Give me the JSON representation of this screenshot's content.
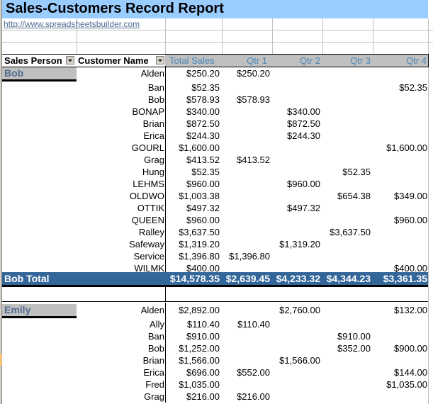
{
  "report": {
    "title": "Sales-Customers Record Report",
    "link": "http://www.spreadsheetsbuilder.com"
  },
  "table": {
    "headers": {
      "sales_person": "Sales Person",
      "customer_name": "Customer Name",
      "total_sales": "Total Sales",
      "qtr1": "Qtr 1",
      "qtr2": "Qtr 2",
      "qtr3": "Qtr 3",
      "qtr4": "Qtr 4"
    },
    "groups": [
      {
        "person": "Bob",
        "rows": [
          {
            "customer": "Alden",
            "total": "$250.20",
            "q1": "$250.20",
            "q2": "",
            "q3": "",
            "q4": ""
          },
          {
            "customer": "Ban",
            "total": "$52.35",
            "q1": "",
            "q2": "",
            "q3": "",
            "q4": "$52.35"
          },
          {
            "customer": "Bob",
            "total": "$578.93",
            "q1": "$578.93",
            "q2": "",
            "q3": "",
            "q4": ""
          },
          {
            "customer": "BONAP",
            "total": "$340.00",
            "q1": "",
            "q2": "$340.00",
            "q3": "",
            "q4": ""
          },
          {
            "customer": "Brian",
            "total": "$872.50",
            "q1": "",
            "q2": "$872.50",
            "q3": "",
            "q4": ""
          },
          {
            "customer": "Erica",
            "total": "$244.30",
            "q1": "",
            "q2": "$244.30",
            "q3": "",
            "q4": ""
          },
          {
            "customer": "GOURL",
            "total": "$1,600.00",
            "q1": "",
            "q2": "",
            "q3": "",
            "q4": "$1,600.00"
          },
          {
            "customer": "Grag",
            "total": "$413.52",
            "q1": "$413.52",
            "q2": "",
            "q3": "",
            "q4": ""
          },
          {
            "customer": "Hung",
            "total": "$52.35",
            "q1": "",
            "q2": "",
            "q3": "$52.35",
            "q4": ""
          },
          {
            "customer": "LEHMS",
            "total": "$960.00",
            "q1": "",
            "q2": "$960.00",
            "q3": "",
            "q4": ""
          },
          {
            "customer": "OLDWO",
            "total": "$1,003.38",
            "q1": "",
            "q2": "",
            "q3": "$654.38",
            "q4": "$349.00"
          },
          {
            "customer": "OTTIK",
            "total": "$497.32",
            "q1": "",
            "q2": "$497.32",
            "q3": "",
            "q4": ""
          },
          {
            "customer": "QUEEN",
            "total": "$960.00",
            "q1": "",
            "q2": "",
            "q3": "",
            "q4": "$960.00"
          },
          {
            "customer": "Ralley",
            "total": "$3,637.50",
            "q1": "",
            "q2": "",
            "q3": "$3,637.50",
            "q4": ""
          },
          {
            "customer": "Safeway",
            "total": "$1,319.20",
            "q1": "",
            "q2": "$1,319.20",
            "q3": "",
            "q4": ""
          },
          {
            "customer": "Service",
            "total": "$1,396.80",
            "q1": "$1,396.80",
            "q2": "",
            "q3": "",
            "q4": ""
          },
          {
            "customer": "WILMK",
            "total": "$400.00",
            "q1": "",
            "q2": "",
            "q3": "",
            "q4": "$400.00"
          }
        ],
        "total_label": "Bob Total",
        "totals": {
          "total": "$14,578.35",
          "q1": "$2,639.45",
          "q2": "$4,233.32",
          "q3": "$4,344.23",
          "q4": "$3,361.35"
        }
      },
      {
        "person": "Emily",
        "rows": [
          {
            "customer": "Alden",
            "total": "$2,892.00",
            "q1": "",
            "q2": "$2,760.00",
            "q3": "",
            "q4": "$132.00"
          },
          {
            "customer": "Ally",
            "total": "$110.40",
            "q1": "$110.40",
            "q2": "",
            "q3": "",
            "q4": ""
          },
          {
            "customer": "Ban",
            "total": "$910.00",
            "q1": "",
            "q2": "",
            "q3": "$910.00",
            "q4": ""
          },
          {
            "customer": "Bob",
            "total": "$1,252.00",
            "q1": "",
            "q2": "",
            "q3": "$352.00",
            "q4": "$900.00"
          },
          {
            "customer": "Brian",
            "total": "$1,566.00",
            "q1": "",
            "q2": "$1,566.00",
            "q3": "",
            "q4": ""
          },
          {
            "customer": "Erica",
            "total": "$696.00",
            "q1": "$552.00",
            "q2": "",
            "q3": "",
            "q4": "$144.00"
          },
          {
            "customer": "Fred",
            "total": "$1,035.00",
            "q1": "",
            "q2": "",
            "q3": "",
            "q4": "$1,035.00"
          },
          {
            "customer": "Grag",
            "total": "$216.00",
            "q1": "$216.00",
            "q2": "",
            "q3": "",
            "q4": ""
          }
        ]
      }
    ]
  },
  "colors": {
    "title_bg": "#99ccff",
    "header_gray": "#c0c0c0",
    "header_blue_text": "#4a86b8",
    "total_row_bg": "#336699",
    "person_text": "#4f6a8f"
  }
}
